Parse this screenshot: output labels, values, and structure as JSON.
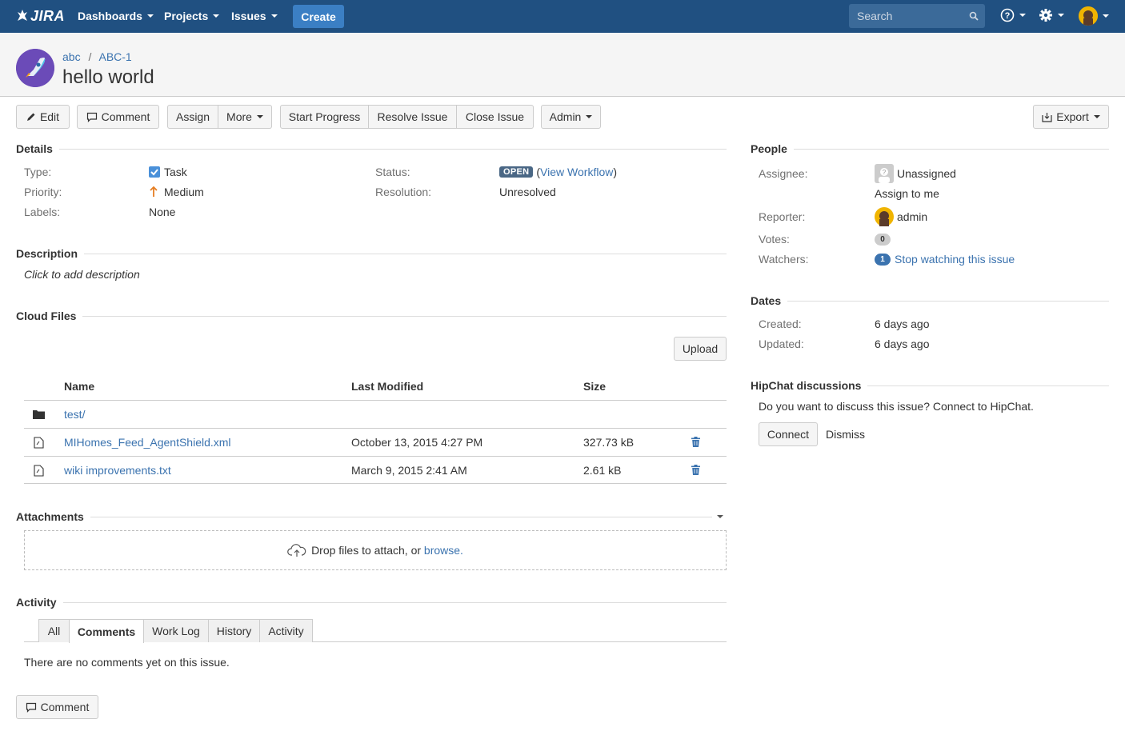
{
  "nav": {
    "logo": "JIRA",
    "dashboards": "Dashboards",
    "projects": "Projects",
    "issues": "Issues",
    "create": "Create",
    "search_placeholder": "Search"
  },
  "header": {
    "project": "abc",
    "separator": "/",
    "issue_key": "ABC-1",
    "title": "hello world"
  },
  "toolbar": {
    "edit": "Edit",
    "comment": "Comment",
    "assign": "Assign",
    "more": "More",
    "start_progress": "Start Progress",
    "resolve_issue": "Resolve Issue",
    "close_issue": "Close Issue",
    "admin": "Admin",
    "export": "Export"
  },
  "details": {
    "heading": "Details",
    "type_label": "Type:",
    "type_value": "Task",
    "priority_label": "Priority:",
    "priority_value": "Medium",
    "labels_label": "Labels:",
    "labels_value": "None",
    "status_label": "Status:",
    "status_value": "OPEN",
    "view_workflow": "View Workflow",
    "resolution_label": "Resolution:",
    "resolution_value": "Unresolved"
  },
  "description": {
    "heading": "Description",
    "placeholder": "Click to add description"
  },
  "cloud_files": {
    "heading": "Cloud Files",
    "upload": "Upload",
    "columns": {
      "name": "Name",
      "modified": "Last Modified",
      "size": "Size"
    },
    "rows": [
      {
        "name": "test/",
        "modified": "",
        "size": "",
        "kind": "folder-icon"
      },
      {
        "name": "MIHomes_Feed_AgentShield.xml",
        "modified": "October 13, 2015 4:27 PM",
        "size": "327.73 kB",
        "kind": "file-icon"
      },
      {
        "name": "wiki improvements.txt",
        "modified": "March 9, 2015 2:41 AM",
        "size": "2.61 kB",
        "kind": "file-icon"
      }
    ]
  },
  "attachments": {
    "heading": "Attachments",
    "drop_text": "Drop files to attach, or",
    "browse": "browse."
  },
  "activity": {
    "heading": "Activity",
    "tabs": [
      "All",
      "Comments",
      "Work Log",
      "History",
      "Activity"
    ],
    "active_tab": "Comments",
    "empty": "There are no comments yet on this issue.",
    "comment_button": "Comment"
  },
  "people": {
    "heading": "People",
    "assignee_label": "Assignee:",
    "assignee_value": "Unassigned",
    "assign_to_me": "Assign to me",
    "reporter_label": "Reporter:",
    "reporter_value": "admin",
    "votes_label": "Votes:",
    "votes_count": "0",
    "watchers_label": "Watchers:",
    "watchers_count": "1",
    "stop_watching": "Stop watching this issue"
  },
  "dates": {
    "heading": "Dates",
    "created_label": "Created:",
    "created_value": "6 days ago",
    "updated_label": "Updated:",
    "updated_value": "6 days ago"
  },
  "hipchat": {
    "heading": "HipChat discussions",
    "prompt": "Do you want to discuss this issue? Connect to HipChat.",
    "connect": "Connect",
    "dismiss": "Dismiss"
  },
  "colors": {
    "nav_bg": "#205081",
    "create_btn": "#3b7fc4",
    "link": "#3b73af",
    "status_lozenge": "#4a6785",
    "priority_medium": "#e67e22"
  }
}
